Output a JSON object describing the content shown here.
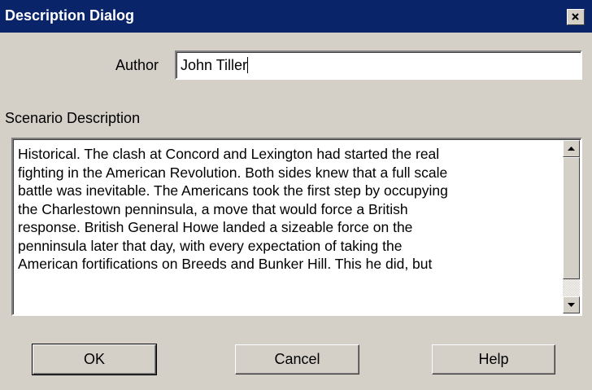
{
  "window": {
    "title": "Description Dialog",
    "close_icon": "close-icon"
  },
  "author": {
    "label": "Author",
    "value": "John Tiller"
  },
  "description": {
    "label": "Scenario Description",
    "text": "Historical.  The clash at Concord and Lexington had started the real\nfighting in the American Revolution.  Both sides knew that a full scale\nbattle was inevitable.  The Americans took the first step by occupying\nthe Charlestown penninsula, a move that would force a British\nresponse.  British General Howe landed a sizeable force on the\npenninsula later that day, with every expectation of taking the\nAmerican fortifications on Breeds and Bunker Hill.  This he did, but"
  },
  "buttons": {
    "ok": "OK",
    "cancel": "Cancel",
    "help": "Help"
  },
  "colors": {
    "titlebar": "#0a246a",
    "face": "#d4d0c8"
  }
}
